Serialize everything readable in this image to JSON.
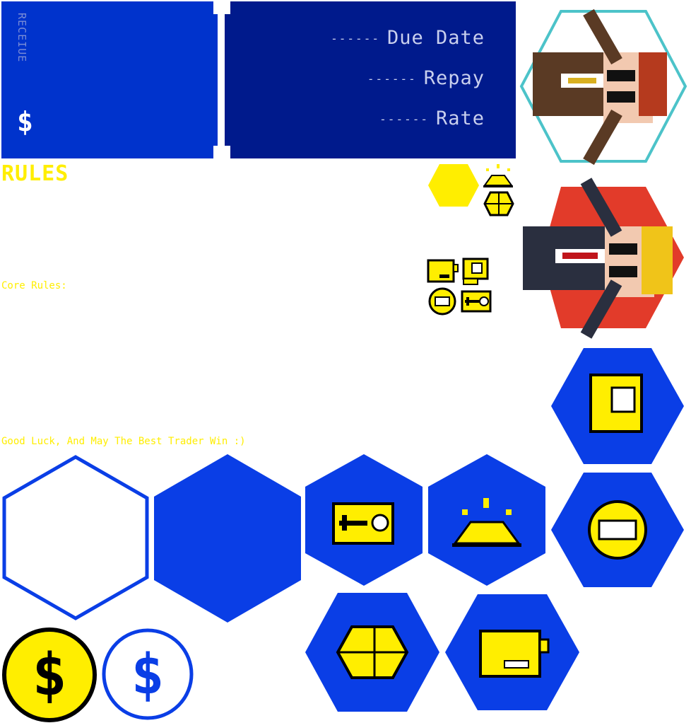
{
  "ticket": {
    "receive_label": "RECEIUE",
    "currency_symbol": "$",
    "due_date_label": "Due Date",
    "repay_label": "Repay",
    "rate_label": "Rate",
    "leader": "------"
  },
  "rules": {
    "title": "RULES",
    "core_rules_label": "Core Rules:",
    "closing_line": "Good Luck, And May The Best Trader Win :)"
  },
  "coins": {
    "symbol": "$"
  },
  "colors": {
    "ticket_blue": "#0033cc",
    "ticket_navy": "#001a8c",
    "hex_blue": "#0a3ee6",
    "yellow": "#ffee00",
    "teal_border": "#4cc3c9",
    "red_tile": "#e23b2a"
  },
  "icons": [
    "trader-portrait-teal",
    "trader-portrait-red",
    "yellow-hex-marker",
    "gold-pile-icon",
    "cube-icon",
    "card-icon",
    "lock-icon",
    "coin-icon",
    "key-icon",
    "hex-tile-outline",
    "hex-tile-solid",
    "hex-tile-key",
    "hex-tile-gold",
    "hex-tile-card",
    "hex-tile-coin",
    "hex-tile-cube",
    "hex-tile-battery",
    "gold-coin",
    "outline-coin"
  ]
}
